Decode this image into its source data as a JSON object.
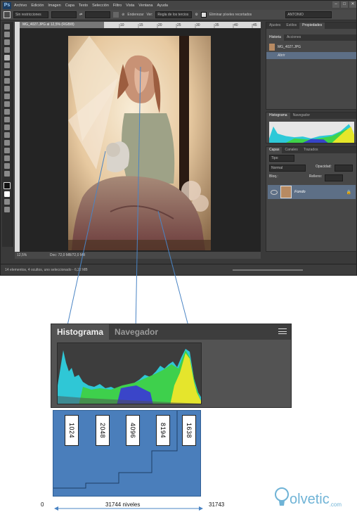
{
  "app": {
    "logo": "Ps",
    "menus": [
      "Archivo",
      "Edición",
      "Imagen",
      "Capa",
      "Texto",
      "Selección",
      "Filtro",
      "Vista",
      "Ventana",
      "Ayuda"
    ],
    "window_controls": [
      "–",
      "□",
      "✕"
    ]
  },
  "options_bar": {
    "ratio_value": "Sin restricciones",
    "straighten_label": "Enderezar",
    "view_label": "Ver:",
    "view_value": "Regla de los tercios",
    "delete_cropped_label": "Eliminar píxeles recortados",
    "workspace_value": "ANTONIO"
  },
  "document": {
    "tab_title": "MG_4027.JPG al 12,5% (RGB/8)",
    "ruler_ticks": [
      "15",
      "10",
      "5",
      "0",
      "5",
      "10",
      "15",
      "20",
      "25",
      "30",
      "35",
      "40",
      "45"
    ],
    "zoom": "12,5%",
    "doc_size": "Doc: 72,0 MB/72,0 MB",
    "bottom_status": "14 elementos, 4 ocultos, uno seleccionado - 6,22 MB"
  },
  "panels": {
    "history_tabs": [
      "Historia",
      "Acciones"
    ],
    "extra_tabs": [
      "Ajustes",
      "Estilos",
      "Propiedades"
    ],
    "history_items": [
      "MG_4027.JPG",
      "Abrir"
    ],
    "hist_nav_tabs": [
      "Histograma",
      "Navegador"
    ],
    "layers_tabs": [
      "Capas",
      "Canales",
      "Trazados"
    ],
    "layer_kind": "Tipo",
    "blend_mode": "Normal",
    "opacity_label": "Opacidad:",
    "lock_label": "Bloq.:",
    "fill_label": "Relleno:",
    "layer_name": "Fondo"
  },
  "zoomed_panel": {
    "tab_active": "Histograma",
    "tab_inactive": "Navegador"
  },
  "levels_diagram": {
    "labels": [
      "1024",
      "2048",
      "4096",
      "8194",
      "1638"
    ],
    "left_value": "0",
    "range_label": "31744 niveles",
    "right_value": "31743"
  },
  "watermark": {
    "text": "olvetic",
    "suffix": ".com"
  },
  "colors": {
    "photoshop_dark": "#3a3a3a",
    "levels_blue": "#4a7ebb",
    "selected_layer": "#5d6f86",
    "arrow_blue": "#4a84c4"
  }
}
